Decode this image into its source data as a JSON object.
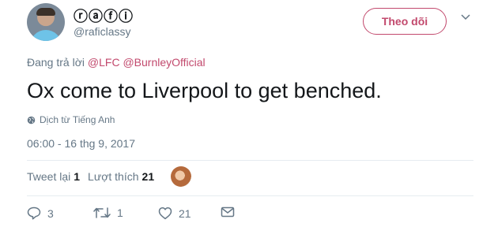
{
  "user": {
    "display_name": "ⓡⓐⓕⓘ",
    "handle": "@raficlassy",
    "avatar_icon": "user-avatar"
  },
  "follow_button": {
    "label": "Theo dõi"
  },
  "more_icon": "chevron-down-icon",
  "reply": {
    "prefix": "Đang trả lời ",
    "mentions": [
      "@LFC",
      "@BurnleyOfficial"
    ]
  },
  "tweet": {
    "text": "Ox come to Liverpool to get benched.",
    "translate_label": "Dịch từ Tiếng Anh",
    "timestamp": "06:00 - 16 thg 9, 2017"
  },
  "stats": {
    "retweets_label": "Tweet lại",
    "retweets_count": "1",
    "likes_label": "Lượt thích",
    "likes_count": "21"
  },
  "actions": {
    "reply_count": "3",
    "retweet_count": "1",
    "like_count": "21"
  },
  "colors": {
    "accent": "#c2496d",
    "text": "#14171a",
    "muted": "#657786",
    "divider": "#e6ecf0"
  }
}
